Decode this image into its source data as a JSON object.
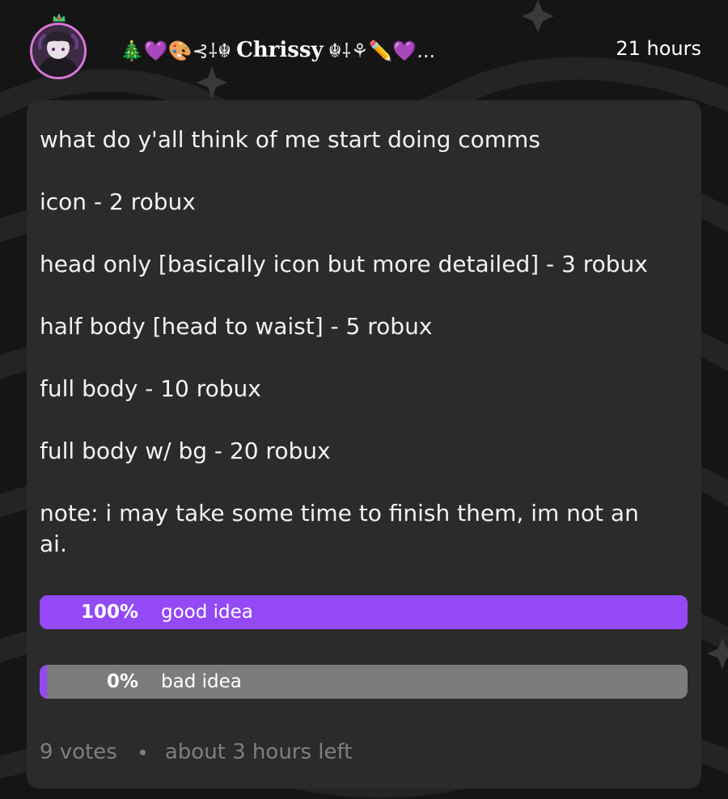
{
  "post": {
    "author": {
      "name": "Chrissy",
      "prefix": "🎄💜🎨⊰⸸☬",
      "suffix": "☬⸸⚘✏️💜...",
      "avatar_icon": "avatar"
    },
    "time": "21 hours",
    "lines": [
      "what do y'all think of me start doing comms",
      "icon - 2 robux",
      "head only [basically icon but more detailed] - 3 robux",
      "half body [head to waist] - 5 robux",
      "full body - 10 robux",
      "full body w/ bg - 20 robux",
      "note: i may take some time to finish them, im not an ai."
    ]
  },
  "poll": {
    "options": [
      {
        "pct_text": "100%",
        "label": "good idea",
        "fraction": 1.0
      },
      {
        "pct_text": "0%",
        "label": "bad idea",
        "fraction": 0.0
      }
    ],
    "votes": "9 votes",
    "time_left": "about 3 hours left"
  },
  "colors": {
    "accent": "#9349f5",
    "card": "#2b2b2b",
    "background": "#151515",
    "muted": "#7f7f7f",
    "avatar_ring": "#d877d6"
  }
}
